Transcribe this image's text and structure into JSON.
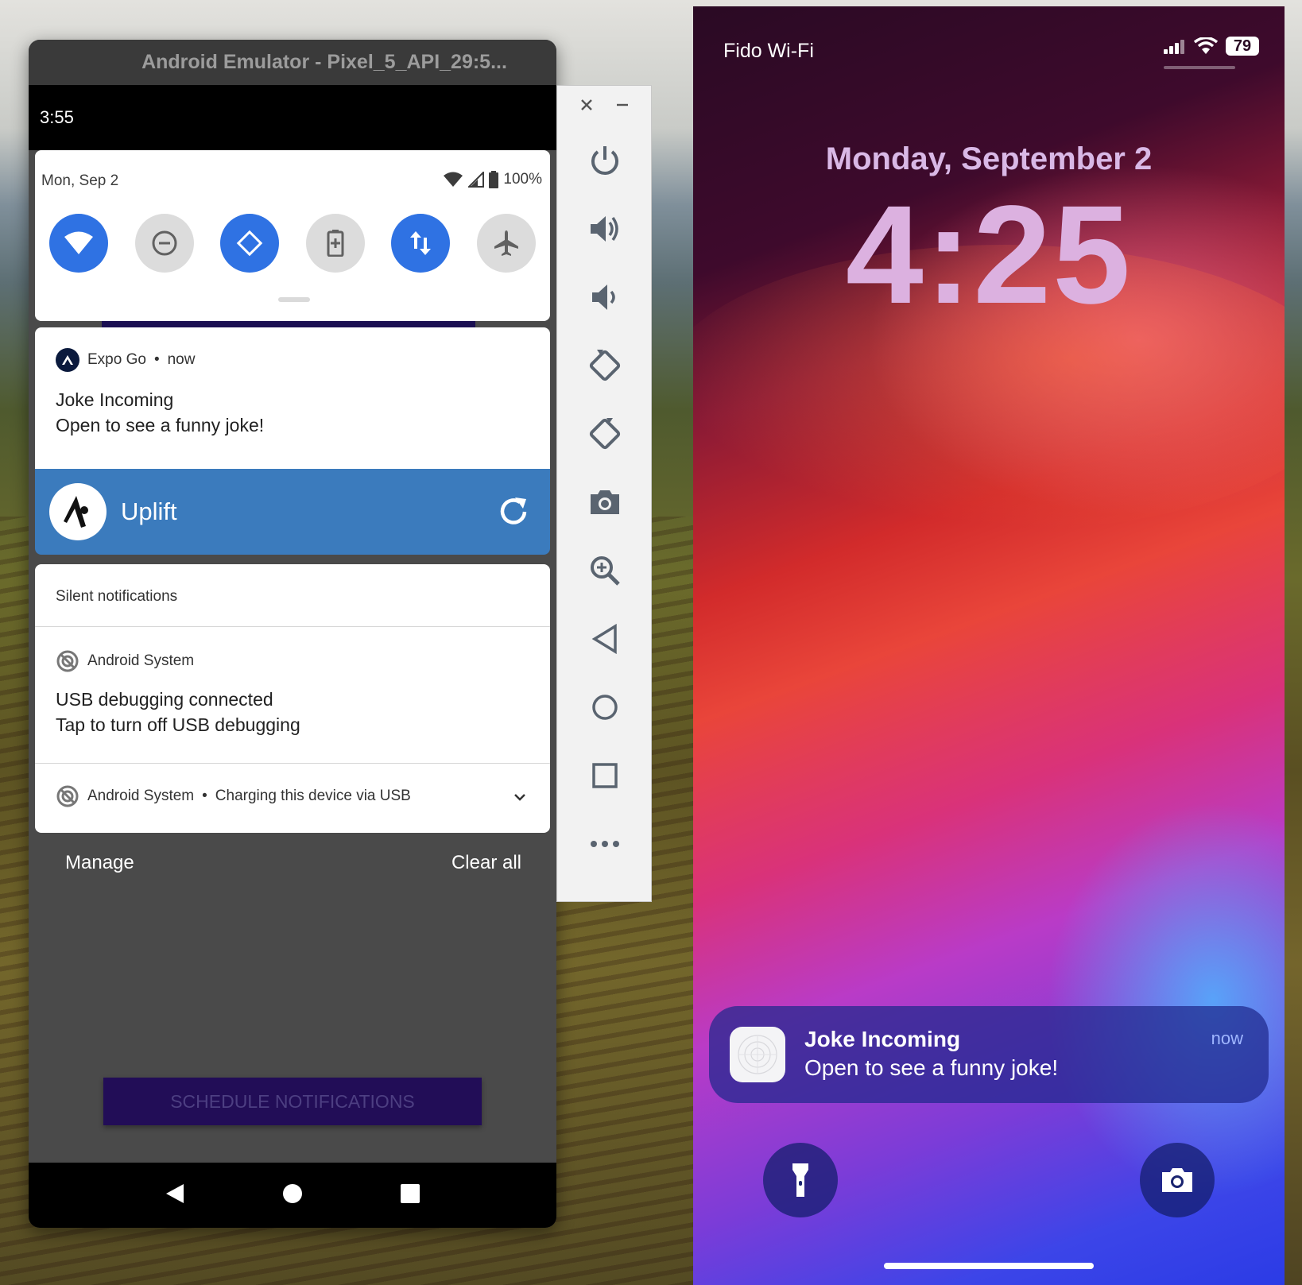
{
  "emulator": {
    "window_title": "Android Emulator - Pixel_5_API_29:5...",
    "status_time": "3:55",
    "quick_settings": {
      "date": "Mon, Sep 2",
      "battery": "100%",
      "tiles": [
        {
          "icon": "wifi-icon",
          "state": "on"
        },
        {
          "icon": "do-not-disturb-icon",
          "state": "off"
        },
        {
          "icon": "auto-rotate-icon",
          "state": "on"
        },
        {
          "icon": "battery-saver-icon",
          "state": "off"
        },
        {
          "icon": "mobile-data-icon",
          "state": "on"
        },
        {
          "icon": "airplane-mode-icon",
          "state": "off"
        }
      ]
    },
    "notification_expo": {
      "app": "Expo Go",
      "separator": "•",
      "time": "now",
      "title": "Joke Incoming",
      "body": "Open to see a funny joke!"
    },
    "uplift": {
      "name": "Uplift"
    },
    "silent": {
      "header": "Silent notifications",
      "usb_app": "Android System",
      "usb_title": "USB debugging connected",
      "usb_body": "Tap to turn off USB debugging",
      "charging_app": "Android System",
      "charging_separator": "•",
      "charging_text": "Charging this device via USB"
    },
    "manage": "Manage",
    "clear_all": "Clear all",
    "schedule_button": "SCHEDULE NOTIFICATIONS"
  },
  "toolbar": {
    "buttons": [
      "close-icon",
      "minimize-icon",
      "power-icon",
      "volume-up-icon",
      "volume-down-icon",
      "rotate-left-icon",
      "rotate-right-icon",
      "screenshot-icon",
      "zoom-icon",
      "back-icon",
      "home-icon",
      "overview-icon",
      "more-icon"
    ]
  },
  "iphone": {
    "carrier": "Fido Wi-Fi",
    "battery": "79",
    "date": "Monday, September 2",
    "time": "4:25",
    "notification": {
      "title": "Joke Incoming",
      "body": "Open to see a funny joke!",
      "time": "now"
    }
  }
}
